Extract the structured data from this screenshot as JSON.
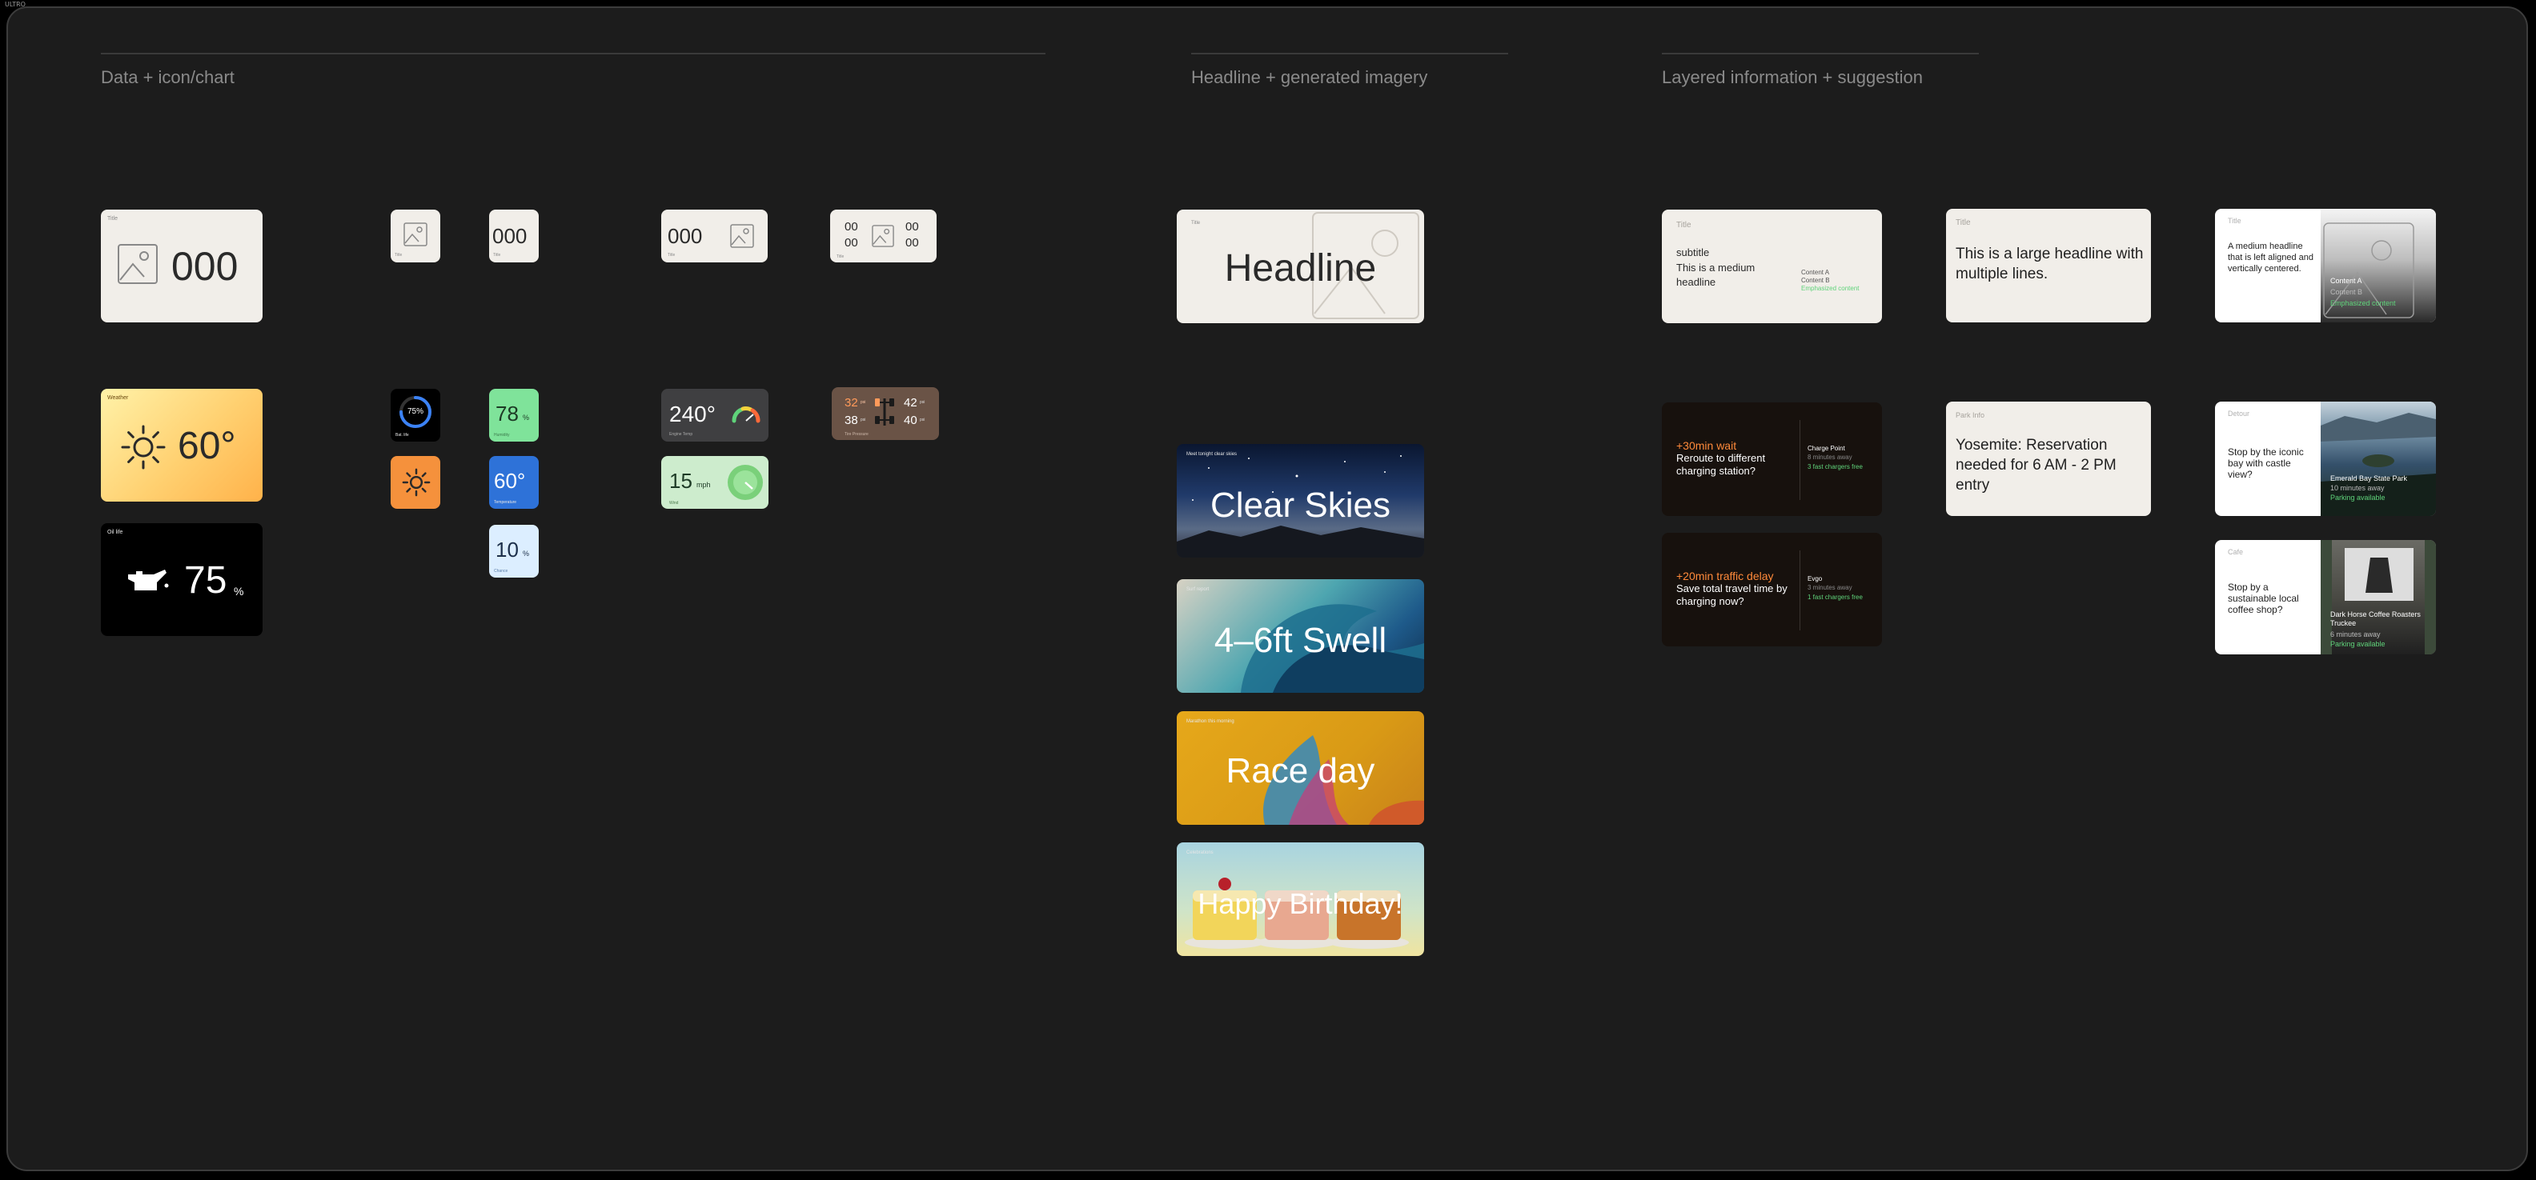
{
  "window": {
    "corner_label": "ULTRO"
  },
  "sections": {
    "data": "Data + icon/chart",
    "headline": "Headline + generated imagery",
    "layered": "Layered information + suggestion"
  },
  "data_cards": {
    "large": {
      "label": "Title",
      "value": "000"
    },
    "small_image": {
      "label": "Title"
    },
    "small_value": {
      "value": "000",
      "label": "Title"
    },
    "wide_value": {
      "value": "000",
      "label": "Title"
    },
    "quad": {
      "tl": "00",
      "bl": "00",
      "tr": "00",
      "br": "00",
      "label": "Title"
    },
    "weather": {
      "label": "Weather",
      "value": "60°"
    },
    "oil": {
      "label": "Oil life",
      "value": "75",
      "unit": "%"
    },
    "ring": {
      "value": "75%",
      "label": "Bat. life",
      "percent": 75
    },
    "green_value": {
      "value": "78",
      "unit": "%",
      "label": "Humidity"
    },
    "blue_value": {
      "value": "60°",
      "label": "Temperature"
    },
    "light_value": {
      "value": "10",
      "unit": "%",
      "label": "Chance"
    },
    "gauge": {
      "value": "240°",
      "label": "Engine Temp"
    },
    "speed": {
      "value": "15",
      "unit": "mph",
      "label": "Wind"
    },
    "tires": {
      "fl": "32",
      "rl": "38",
      "fr": "42",
      "rr": "40",
      "unit": "psi",
      "label": "Tire Pressure"
    }
  },
  "headline_cards": {
    "template": {
      "label": "Title",
      "headline": "Headline"
    },
    "clear_skies": {
      "label": "Meet tonight clear skies",
      "headline": "Clear Skies"
    },
    "swell": {
      "label": "Surf report",
      "headline": "4–6ft Swell"
    },
    "race": {
      "label": "Marathon this morning",
      "headline": "Race day"
    },
    "birthday": {
      "label": "Celebrations",
      "headline": "Happy Birthday!"
    }
  },
  "layered_cards": {
    "medium": {
      "title": "Title",
      "subtitle": "subtitle",
      "headline": "This is a medium headline",
      "content_a": "Content A",
      "content_b": "Content B",
      "emphasized": "Emphasized content"
    },
    "large": {
      "title": "Title",
      "headline": "This is a large headline with multiple lines."
    },
    "split": {
      "title": "Title",
      "headline": "A medium headline that is left aligned and vertically centered.",
      "content_a": "Content A",
      "content_b": "Content B",
      "emphasized": "Emphasized content"
    },
    "charge1": {
      "alert": "+30min wait",
      "text": "Reroute to different charging station?",
      "place": "Charge Point",
      "distance": "8 minutes away",
      "status": "3 fast chargers free"
    },
    "charge2": {
      "alert": "+20min traffic delay",
      "text": "Save total travel time by charging now?",
      "place": "Evgo",
      "distance": "3 minutes away",
      "status": "1 fast chargers free"
    },
    "park": {
      "title": "Park Info",
      "headline": "Yosemite: Reservation needed for 6 AM - 2 PM entry"
    },
    "detour": {
      "title": "Detour",
      "headline": "Stop by the iconic bay with castle view?",
      "place": "Emerald Bay State Park",
      "distance": "10 minutes away",
      "status": "Parking available"
    },
    "cafe": {
      "title": "Cafe",
      "headline": "Stop by a sustainable local coffee shop?",
      "place": "Dark Horse Coffee Roasters Truckee",
      "distance": "6 minutes away",
      "status": "Parking available"
    }
  },
  "colors": {
    "canvas": "#1c1c1c",
    "cream": "#f1eee9",
    "green": "#5fd37a",
    "orange": "#ff8a3a"
  }
}
